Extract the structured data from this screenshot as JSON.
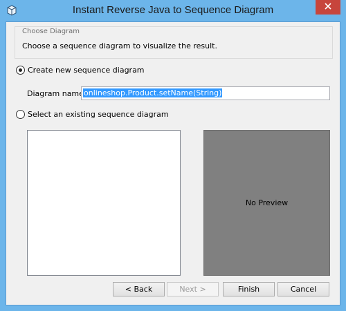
{
  "window": {
    "title": "Instant Reverse Java to Sequence Diagram",
    "icon": "cube-icon",
    "close_icon": "close-icon"
  },
  "group": {
    "title": "Choose Diagram",
    "description": "Choose a sequence diagram to visualize the result."
  },
  "options": {
    "create_new": {
      "label": "Create new sequence diagram",
      "checked": true
    },
    "select_existing": {
      "label": "Select an existing sequence diagram",
      "checked": false
    }
  },
  "diagram_name": {
    "label": "Diagram name:",
    "value": "onlineshop.Product.setName(String)"
  },
  "existing_list": {
    "items": []
  },
  "preview": {
    "text": "No Preview"
  },
  "buttons": {
    "back": "< Back",
    "next": "Next >",
    "finish": "Finish",
    "cancel": "Cancel"
  },
  "colors": {
    "title_bar": "#6cb5ea",
    "close_button": "#c7453c",
    "preview_bg": "#808080",
    "selection": "#3399ff"
  }
}
